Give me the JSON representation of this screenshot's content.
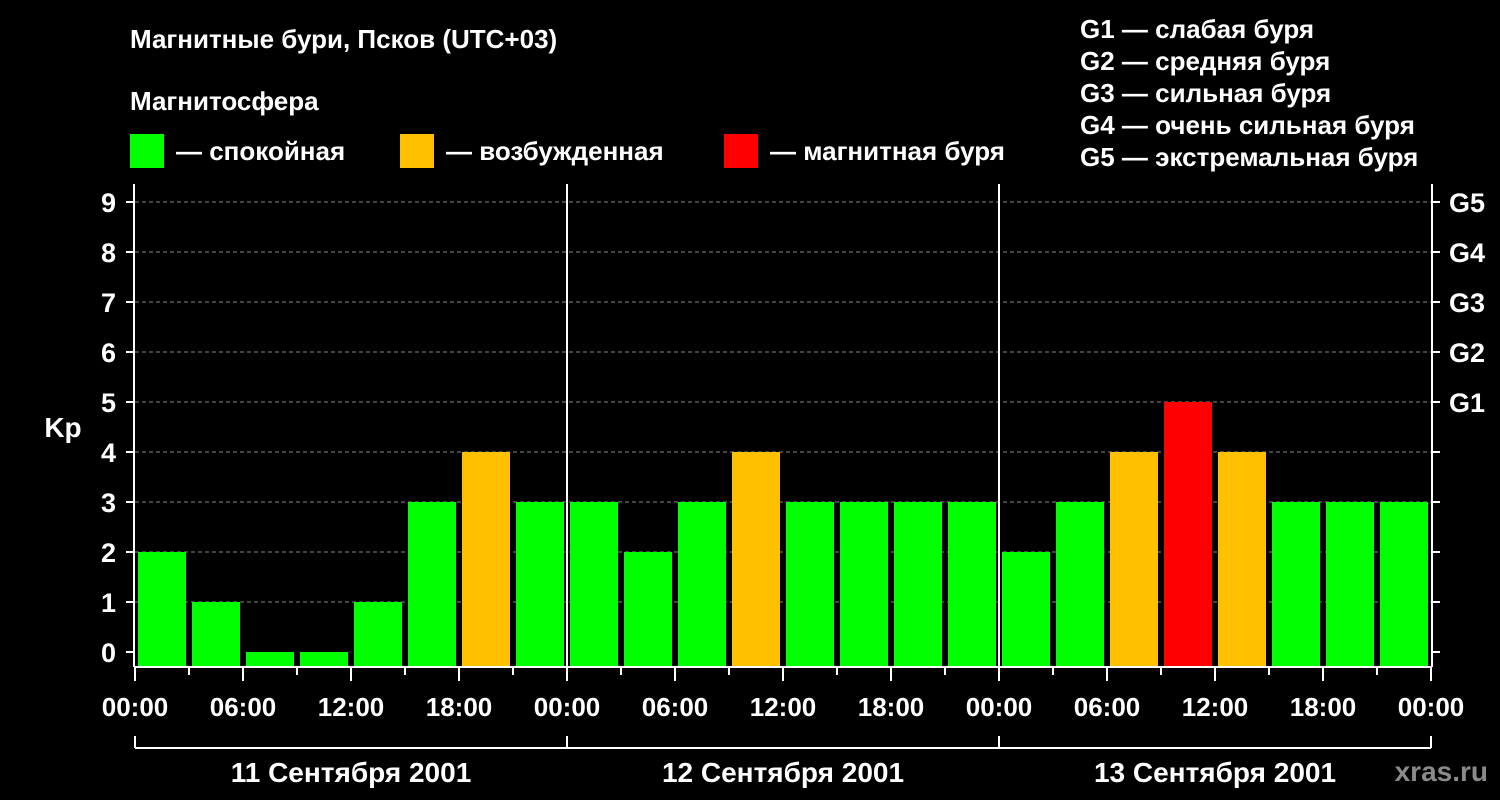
{
  "title": "Магнитные бури, Псков (UTC+03)",
  "subtitle": "Магнитосфера",
  "legend": [
    {
      "color": "#00ff00",
      "label": "— спокойная"
    },
    {
      "color": "#ffc000",
      "label": "— возбужденная"
    },
    {
      "color": "#ff0000",
      "label": "— магнитная буря"
    }
  ],
  "g_levels": [
    "G1 — слабая буря",
    "G2 — средняя буря",
    "G3 — сильная буря",
    "G4 — очень сильная буря",
    "G5 — экстремальная буря"
  ],
  "watermark": "xras.ru",
  "chart_data": {
    "type": "bar",
    "title": "Магнитные бури, Псков (UTC+03)",
    "ylabel": "Kp",
    "ylim": [
      0,
      9
    ],
    "yticks": [
      "0",
      "1",
      "2",
      "3",
      "4",
      "5",
      "6",
      "7",
      "8",
      "9"
    ],
    "right_ticks": [
      {
        "value": 5,
        "label": "G1"
      },
      {
        "value": 6,
        "label": "G2"
      },
      {
        "value": 7,
        "label": "G3"
      },
      {
        "value": 8,
        "label": "G4"
      },
      {
        "value": 9,
        "label": "G5"
      }
    ],
    "grid": "horizontal dashed",
    "xticks": [
      "00:00",
      "06:00",
      "12:00",
      "18:00",
      "00:00",
      "06:00",
      "12:00",
      "18:00",
      "00:00",
      "06:00",
      "12:00",
      "18:00",
      "00:00"
    ],
    "days": [
      "11 Сентября 2001",
      "12 Сентября 2001",
      "13 Сентября 2001"
    ],
    "values": [
      2,
      1,
      0,
      0,
      1,
      3,
      4,
      3,
      3,
      2,
      3,
      4,
      3,
      3,
      3,
      3,
      2,
      3,
      4,
      5,
      4,
      3,
      3,
      3
    ],
    "colors": [
      "#00ff00",
      "#00ff00",
      "#00ff00",
      "#00ff00",
      "#00ff00",
      "#00ff00",
      "#ffc000",
      "#00ff00",
      "#00ff00",
      "#00ff00",
      "#00ff00",
      "#ffc000",
      "#00ff00",
      "#00ff00",
      "#00ff00",
      "#00ff00",
      "#00ff00",
      "#00ff00",
      "#ffc000",
      "#ff0000",
      "#ffc000",
      "#00ff00",
      "#00ff00",
      "#00ff00"
    ]
  }
}
